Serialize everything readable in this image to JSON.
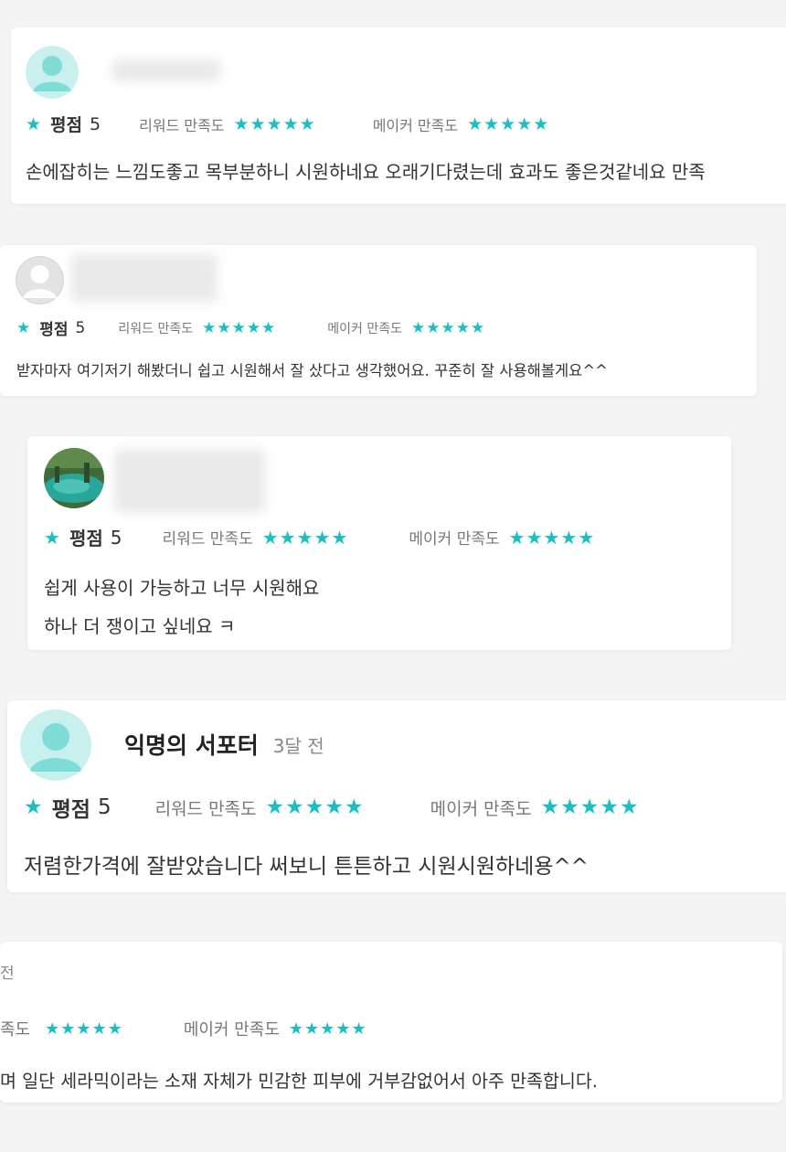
{
  "accent_color": "#1bbfc2",
  "reviews": [
    {
      "score_label": "평점",
      "score_value": "5",
      "reward_label": "리워드 만족도",
      "reward_stars": "★★★★★",
      "maker_label": "메이커 만족도",
      "maker_stars": "★★★★★",
      "comment": "손에잡히는 느낌도좋고 목부분하니 시원하네요 오래기다렸는데 효과도 좋은것같네요 만족"
    },
    {
      "score_label": "평점",
      "score_value": "5",
      "reward_label": "리워드 만족도",
      "reward_stars": "★★★★★",
      "maker_label": "메이커 만족도",
      "maker_stars": "★★★★★",
      "comment": "받자마자 여기저기 해봤더니 쉽고 시원해서 잘 샀다고 생각했어요. 꾸준히 잘 사용해볼게요^^"
    },
    {
      "score_label": "평점",
      "score_value": "5",
      "reward_label": "리워드 만족도",
      "reward_stars": "★★★★★",
      "maker_label": "메이커 만족도",
      "maker_stars": "★★★★★",
      "comment_line1": "쉽게 사용이 가능하고 너무 시원해요",
      "comment_line2": "하나 더 쟁이고 싶네요 ㅋ"
    },
    {
      "author": "익명의 서포터",
      "time": "3달 전",
      "score_label": "평점",
      "score_value": "5",
      "reward_label": "리워드 만족도",
      "reward_stars": "★★★★★",
      "maker_label": "메이커 만족도",
      "maker_stars": "★★★★★",
      "comment": "저렴한가격에 잘받았습니다 써보니 튼튼하고 시원시원하네용^^"
    },
    {
      "time_partial": "전",
      "reward_label_partial": "족도",
      "reward_stars": "★★★★★",
      "maker_label": "메이커 만족도",
      "maker_stars": "★★★★★",
      "comment_partial": "며 일단 세라믹이라는 소재 자체가 민감한 피부에 거부감없어서 아주 만족합니다."
    }
  ]
}
